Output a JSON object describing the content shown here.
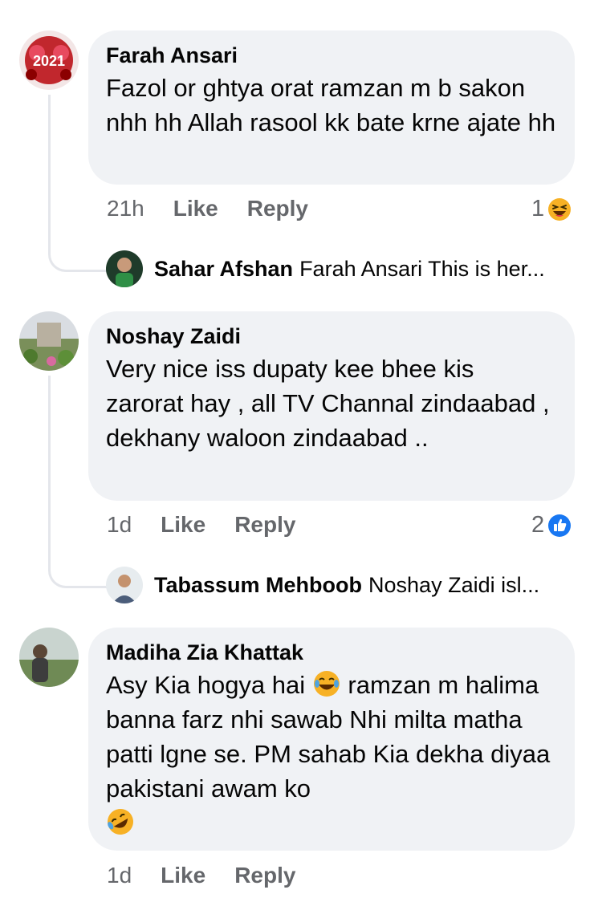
{
  "comments": [
    {
      "author": "Farah Ansari",
      "avatar_text": "2021",
      "text": "Fazol or ghtya orat ramzan m b sakon nhh hh Allah rasool kk bate krne ajate hh",
      "time": "21h",
      "like_label": "Like",
      "reply_label": "Reply",
      "reaction_count": "1",
      "reaction_icon": "laughing-emoji-icon",
      "reply_preview": {
        "author": "Sahar Afshan",
        "text": "Farah Ansari This is her..."
      }
    },
    {
      "author": "Noshay Zaidi",
      "text": "Very nice iss dupaty kee bhee kis zarorat hay , all TV Channal zindaabad , dekhany waloon zindaabad ..",
      "time": "1d",
      "like_label": "Like",
      "reply_label": "Reply",
      "reaction_count": "2",
      "reaction_icon": "thumbs-up-icon",
      "reply_preview": {
        "author": "Tabassum Mehboob",
        "text": "Noshay Zaidi isl..."
      }
    },
    {
      "author": "Madiha Zia Khattak",
      "text_part1": "Asy Kia hogya hai",
      "text_part2": "ramzan m halima banna farz nhi sawab Nhi milta matha patti lgne se. PM sahab Kia dekha diyaa pakistani awam ko",
      "time": "1d",
      "like_label": "Like",
      "reply_label": "Reply"
    }
  ],
  "colors": {
    "bubble": "#f0f2f5",
    "meta": "#65676b",
    "like_blue": "#1877f2",
    "emoji_yellow": "#f7b125"
  }
}
